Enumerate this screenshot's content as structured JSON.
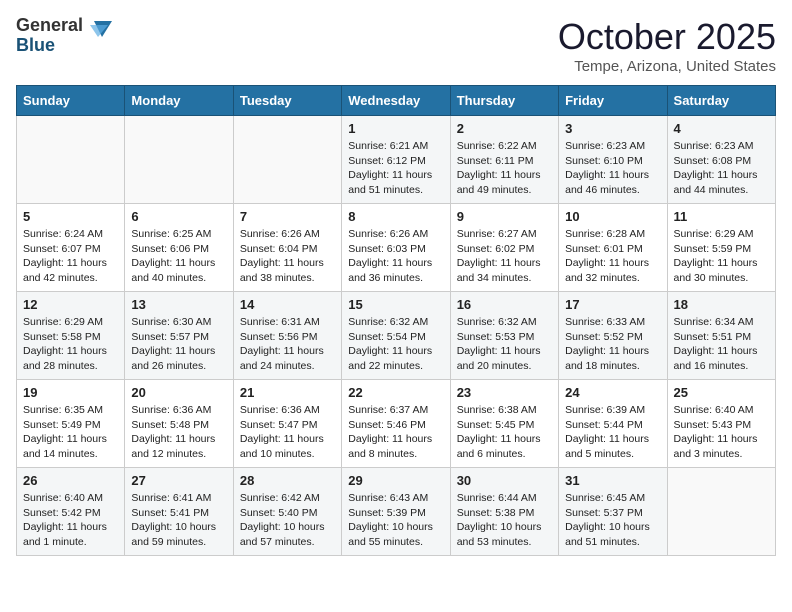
{
  "header": {
    "logo_general": "General",
    "logo_blue": "Blue",
    "title": "October 2025",
    "subtitle": "Tempe, Arizona, United States"
  },
  "columns": [
    "Sunday",
    "Monday",
    "Tuesday",
    "Wednesday",
    "Thursday",
    "Friday",
    "Saturday"
  ],
  "weeks": [
    [
      {
        "day": "",
        "info": ""
      },
      {
        "day": "",
        "info": ""
      },
      {
        "day": "",
        "info": ""
      },
      {
        "day": "1",
        "info": "Sunrise: 6:21 AM\nSunset: 6:12 PM\nDaylight: 11 hours\nand 51 minutes."
      },
      {
        "day": "2",
        "info": "Sunrise: 6:22 AM\nSunset: 6:11 PM\nDaylight: 11 hours\nand 49 minutes."
      },
      {
        "day": "3",
        "info": "Sunrise: 6:23 AM\nSunset: 6:10 PM\nDaylight: 11 hours\nand 46 minutes."
      },
      {
        "day": "4",
        "info": "Sunrise: 6:23 AM\nSunset: 6:08 PM\nDaylight: 11 hours\nand 44 minutes."
      }
    ],
    [
      {
        "day": "5",
        "info": "Sunrise: 6:24 AM\nSunset: 6:07 PM\nDaylight: 11 hours\nand 42 minutes."
      },
      {
        "day": "6",
        "info": "Sunrise: 6:25 AM\nSunset: 6:06 PM\nDaylight: 11 hours\nand 40 minutes."
      },
      {
        "day": "7",
        "info": "Sunrise: 6:26 AM\nSunset: 6:04 PM\nDaylight: 11 hours\nand 38 minutes."
      },
      {
        "day": "8",
        "info": "Sunrise: 6:26 AM\nSunset: 6:03 PM\nDaylight: 11 hours\nand 36 minutes."
      },
      {
        "day": "9",
        "info": "Sunrise: 6:27 AM\nSunset: 6:02 PM\nDaylight: 11 hours\nand 34 minutes."
      },
      {
        "day": "10",
        "info": "Sunrise: 6:28 AM\nSunset: 6:01 PM\nDaylight: 11 hours\nand 32 minutes."
      },
      {
        "day": "11",
        "info": "Sunrise: 6:29 AM\nSunset: 5:59 PM\nDaylight: 11 hours\nand 30 minutes."
      }
    ],
    [
      {
        "day": "12",
        "info": "Sunrise: 6:29 AM\nSunset: 5:58 PM\nDaylight: 11 hours\nand 28 minutes."
      },
      {
        "day": "13",
        "info": "Sunrise: 6:30 AM\nSunset: 5:57 PM\nDaylight: 11 hours\nand 26 minutes."
      },
      {
        "day": "14",
        "info": "Sunrise: 6:31 AM\nSunset: 5:56 PM\nDaylight: 11 hours\nand 24 minutes."
      },
      {
        "day": "15",
        "info": "Sunrise: 6:32 AM\nSunset: 5:54 PM\nDaylight: 11 hours\nand 22 minutes."
      },
      {
        "day": "16",
        "info": "Sunrise: 6:32 AM\nSunset: 5:53 PM\nDaylight: 11 hours\nand 20 minutes."
      },
      {
        "day": "17",
        "info": "Sunrise: 6:33 AM\nSunset: 5:52 PM\nDaylight: 11 hours\nand 18 minutes."
      },
      {
        "day": "18",
        "info": "Sunrise: 6:34 AM\nSunset: 5:51 PM\nDaylight: 11 hours\nand 16 minutes."
      }
    ],
    [
      {
        "day": "19",
        "info": "Sunrise: 6:35 AM\nSunset: 5:49 PM\nDaylight: 11 hours\nand 14 minutes."
      },
      {
        "day": "20",
        "info": "Sunrise: 6:36 AM\nSunset: 5:48 PM\nDaylight: 11 hours\nand 12 minutes."
      },
      {
        "day": "21",
        "info": "Sunrise: 6:36 AM\nSunset: 5:47 PM\nDaylight: 11 hours\nand 10 minutes."
      },
      {
        "day": "22",
        "info": "Sunrise: 6:37 AM\nSunset: 5:46 PM\nDaylight: 11 hours\nand 8 minutes."
      },
      {
        "day": "23",
        "info": "Sunrise: 6:38 AM\nSunset: 5:45 PM\nDaylight: 11 hours\nand 6 minutes."
      },
      {
        "day": "24",
        "info": "Sunrise: 6:39 AM\nSunset: 5:44 PM\nDaylight: 11 hours\nand 5 minutes."
      },
      {
        "day": "25",
        "info": "Sunrise: 6:40 AM\nSunset: 5:43 PM\nDaylight: 11 hours\nand 3 minutes."
      }
    ],
    [
      {
        "day": "26",
        "info": "Sunrise: 6:40 AM\nSunset: 5:42 PM\nDaylight: 11 hours\nand 1 minute."
      },
      {
        "day": "27",
        "info": "Sunrise: 6:41 AM\nSunset: 5:41 PM\nDaylight: 10 hours\nand 59 minutes."
      },
      {
        "day": "28",
        "info": "Sunrise: 6:42 AM\nSunset: 5:40 PM\nDaylight: 10 hours\nand 57 minutes."
      },
      {
        "day": "29",
        "info": "Sunrise: 6:43 AM\nSunset: 5:39 PM\nDaylight: 10 hours\nand 55 minutes."
      },
      {
        "day": "30",
        "info": "Sunrise: 6:44 AM\nSunset: 5:38 PM\nDaylight: 10 hours\nand 53 minutes."
      },
      {
        "day": "31",
        "info": "Sunrise: 6:45 AM\nSunset: 5:37 PM\nDaylight: 10 hours\nand 51 minutes."
      },
      {
        "day": "",
        "info": ""
      }
    ]
  ]
}
